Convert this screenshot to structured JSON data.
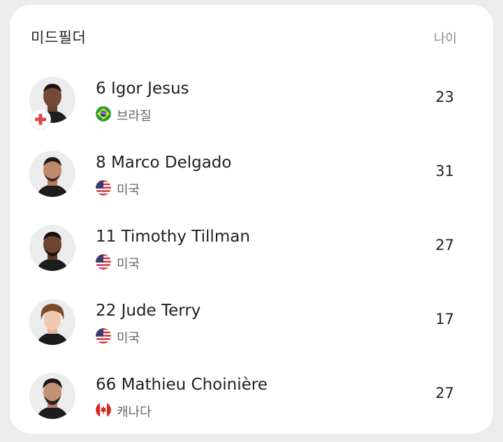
{
  "section": {
    "title": "미드필더",
    "age_header": "나이"
  },
  "players": [
    {
      "name": "6 Igor Jesus",
      "country": "브라질",
      "flag_icon": "brazil-flag-icon",
      "age": "23",
      "injured": true
    },
    {
      "name": "8 Marco Delgado",
      "country": "미국",
      "flag_icon": "usa-flag-icon",
      "age": "31",
      "injured": false
    },
    {
      "name": "11 Timothy Tillman",
      "country": "미국",
      "flag_icon": "usa-flag-icon",
      "age": "27",
      "injured": false
    },
    {
      "name": "22 Jude Terry",
      "country": "미국",
      "flag_icon": "usa-flag-icon",
      "age": "17",
      "injured": false
    },
    {
      "name": "66 Mathieu Choinière",
      "country": "캐나다",
      "flag_icon": "canada-flag-icon",
      "age": "27",
      "injured": false
    }
  ],
  "colors": {
    "injury_cross": "#e04848",
    "background": "#ececec",
    "card": "#ffffff"
  }
}
